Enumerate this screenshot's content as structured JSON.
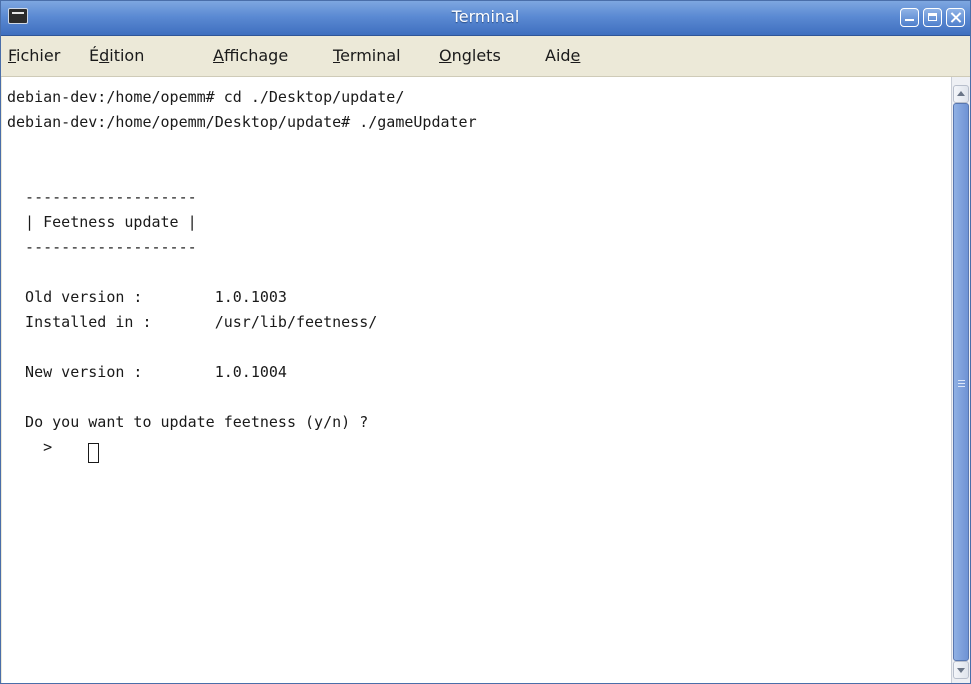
{
  "window": {
    "title": "Terminal"
  },
  "menubar": {
    "items": [
      {
        "pre": "",
        "acc": "F",
        "post": "ichier"
      },
      {
        "pre": "É",
        "acc": "d",
        "post": "ition"
      },
      {
        "pre": "",
        "acc": "A",
        "post": "ffichage"
      },
      {
        "pre": "",
        "acc": "T",
        "post": "erminal"
      },
      {
        "pre": "",
        "acc": "O",
        "post": "nglets"
      },
      {
        "pre": "Aid",
        "acc": "e",
        "post": ""
      }
    ]
  },
  "terminal": {
    "lines": [
      "debian-dev:/home/opemm# cd ./Desktop/update/",
      "debian-dev:/home/opemm/Desktop/update# ./gameUpdater",
      "",
      "",
      "  -------------------",
      "  | Feetness update |",
      "  -------------------",
      "",
      "  Old version :        1.0.1003",
      "  Installed in :       /usr/lib/feetness/",
      "",
      "  New version :        1.0.1004",
      "",
      "  Do you want to update feetness (y/n) ?",
      "    >"
    ]
  },
  "colors": {
    "titlebar": "#5b8ad3",
    "menubar": "#ece9d8",
    "terminal_bg": "#ffffff",
    "terminal_fg": "#1a1a1a",
    "scroll_thumb": "#7ea2de"
  },
  "icons": {
    "app": "terminal-icon",
    "minimize": "minimize-icon",
    "maximize": "maximize-icon",
    "close": "close-icon"
  }
}
